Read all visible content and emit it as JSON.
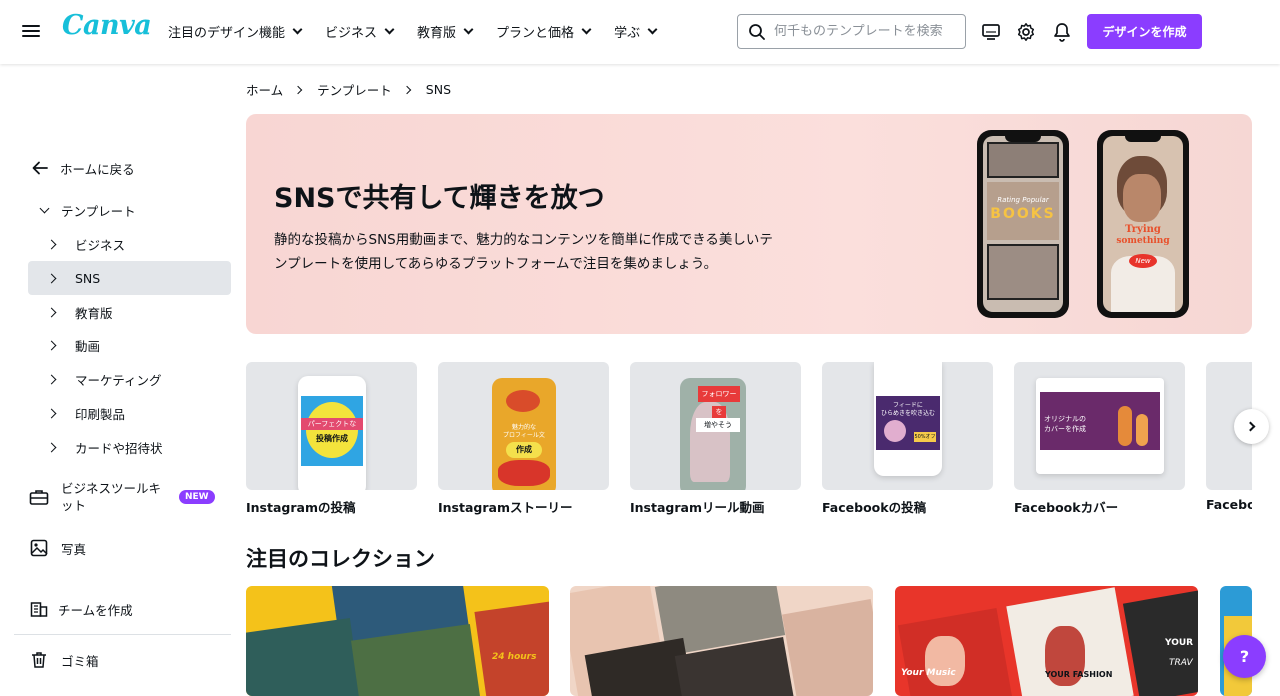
{
  "brand": {
    "logo_text": "Canva",
    "accent": "#8b3dff",
    "logo_color": "#17bfd9"
  },
  "topbar": {
    "nav": [
      "注目のデザイン機能",
      "ビジネス",
      "教育版",
      "プランと価格",
      "学ぶ"
    ],
    "search_placeholder": "何千ものテンプレートを検索",
    "cta_label": "デザインを作成",
    "icons": [
      "menu-icon",
      "search-icon",
      "desktop-icon",
      "gear-icon",
      "bell-icon"
    ]
  },
  "sidebar": {
    "back_label": "ホームに戻る",
    "templates_label": "テンプレート",
    "subitems": [
      "ビジネス",
      "SNS",
      "教育版",
      "動画",
      "マーケティング",
      "印刷製品",
      "カードや招待状"
    ],
    "active_item": "SNS",
    "business_kit_label": "ビジネスツールキット",
    "new_badge": "NEW",
    "photos_label": "写真",
    "team_label": "チームを作成",
    "trash_label": "ゴミ箱"
  },
  "breadcrumb": [
    "ホーム",
    "テンプレート",
    "SNS"
  ],
  "hero": {
    "title": "SNSで共有して輝きを放つ",
    "description": "静的な投稿からSNS用動画まで、魅力的なコンテンツを簡単に作成できる美しいテンプレートを使用してあらゆるプラットフォームで注目を集めましょう。",
    "phone1_text": [
      "Rating Popular",
      "BOOKS"
    ],
    "phone2_text": [
      "Trying",
      "something",
      "New"
    ]
  },
  "categories": [
    {
      "label": "Instagramの投稿",
      "thumb_text": [
        "パーフェクトな",
        "投稿作成"
      ]
    },
    {
      "label": "Instagramストーリー",
      "thumb_text": [
        "魅力的な",
        "プロフィール文",
        "作成"
      ]
    },
    {
      "label": "Instagramリール動画",
      "thumb_text": [
        "フォロワー",
        "を",
        "増やそう"
      ]
    },
    {
      "label": "Facebookの投稿",
      "thumb_text": [
        "フィードに",
        "ひらめきを吹き込む",
        "50%オフ"
      ]
    },
    {
      "label": "Facebookカバー",
      "thumb_text": [
        "オリジナルの",
        "カバーを作成"
      ]
    },
    {
      "label": "Facebook"
    }
  ],
  "collections_title": "注目のコレクション",
  "collections_text": [
    "24 hours",
    "YOUR FASHION",
    "YOUR",
    "TRAV",
    "Your Music"
  ],
  "help_label": "?"
}
